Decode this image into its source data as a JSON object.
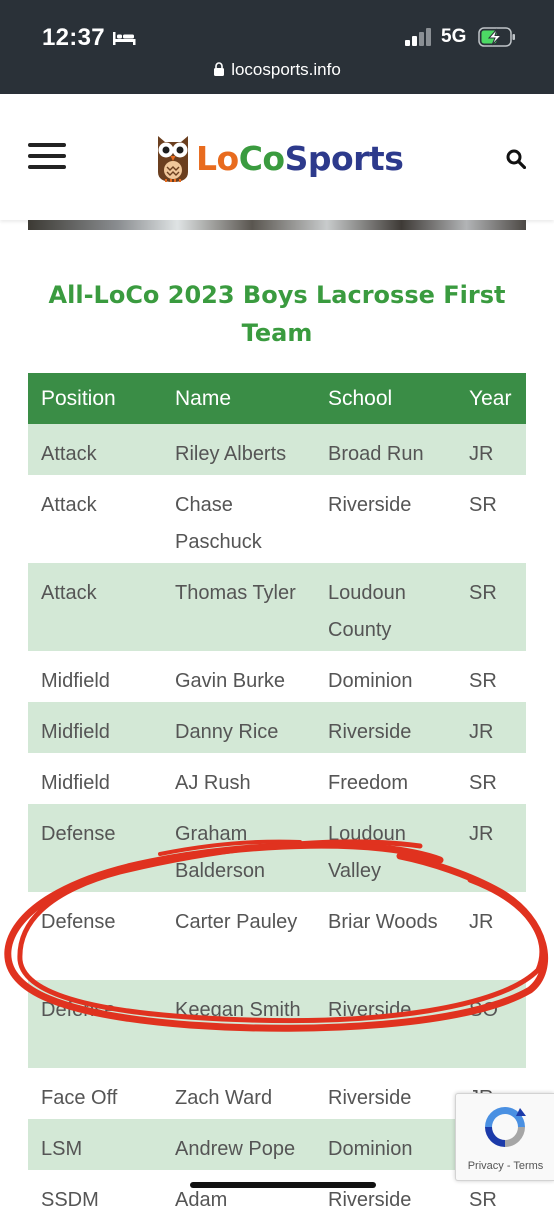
{
  "status_bar": {
    "time": "12:37",
    "network": "5G",
    "icons": [
      "bed-icon",
      "signal-icon",
      "battery-charging-icon"
    ]
  },
  "browser": {
    "url": "locosports.info",
    "icons": [
      "lock-icon"
    ]
  },
  "header": {
    "logo_text_lo": "Lo",
    "logo_text_co": "Co",
    "logo_text_sports": "Sports",
    "icons": [
      "hamburger-menu-icon",
      "owl-logo-icon",
      "search-icon"
    ],
    "colors": {
      "lo": "#e86b1e",
      "co": "#3a9b3f",
      "sports": "#2d3a8c"
    }
  },
  "article": {
    "title": "All-LoCo 2023 Boys Lacrosse First Team"
  },
  "table": {
    "header_color": "#3a8d46",
    "stripe_color": "#d3e8d6",
    "columns": [
      "Position",
      "Name",
      "School",
      "Year"
    ],
    "rows": [
      {
        "position": "Attack",
        "name": "Riley Alberts",
        "school": "Broad Run",
        "year": "JR"
      },
      {
        "position": "Attack",
        "name": "Chase Paschuck",
        "school": "Riverside",
        "year": "SR"
      },
      {
        "position": "Attack",
        "name": "Thomas Tyler",
        "school": "Loudoun County",
        "year": "SR"
      },
      {
        "position": "Midfield",
        "name": "Gavin Burke",
        "school": "Dominion",
        "year": "SR"
      },
      {
        "position": "Midfield",
        "name": "Danny Rice",
        "school": "Riverside",
        "year": "JR"
      },
      {
        "position": "Midfield",
        "name": "AJ Rush",
        "school": "Freedom",
        "year": "SR"
      },
      {
        "position": "Defense",
        "name": "Graham Balderson",
        "school": "Loudoun Valley",
        "year": "JR"
      },
      {
        "position": "Defense",
        "name": "Carter Pauley",
        "school": "Briar Woods",
        "year": "JR"
      },
      {
        "position": "Defense",
        "name": "Keegan Smith",
        "school": "Riverside",
        "year": "SO"
      },
      {
        "position": "Face Off",
        "name": "Zach Ward",
        "school": "Riverside",
        "year": "JR"
      },
      {
        "position": "LSM",
        "name": "Andrew Pope",
        "school": "Dominion",
        "year": ""
      },
      {
        "position": "SSDM",
        "name": "Adam",
        "school": "Riverside",
        "year": "SR"
      }
    ]
  },
  "annotation": {
    "color": "#e0321f",
    "highlighted_row": "Carter Pauley"
  },
  "recaptcha": {
    "links": "Privacy - Terms",
    "icons": [
      "recaptcha-icon"
    ]
  }
}
